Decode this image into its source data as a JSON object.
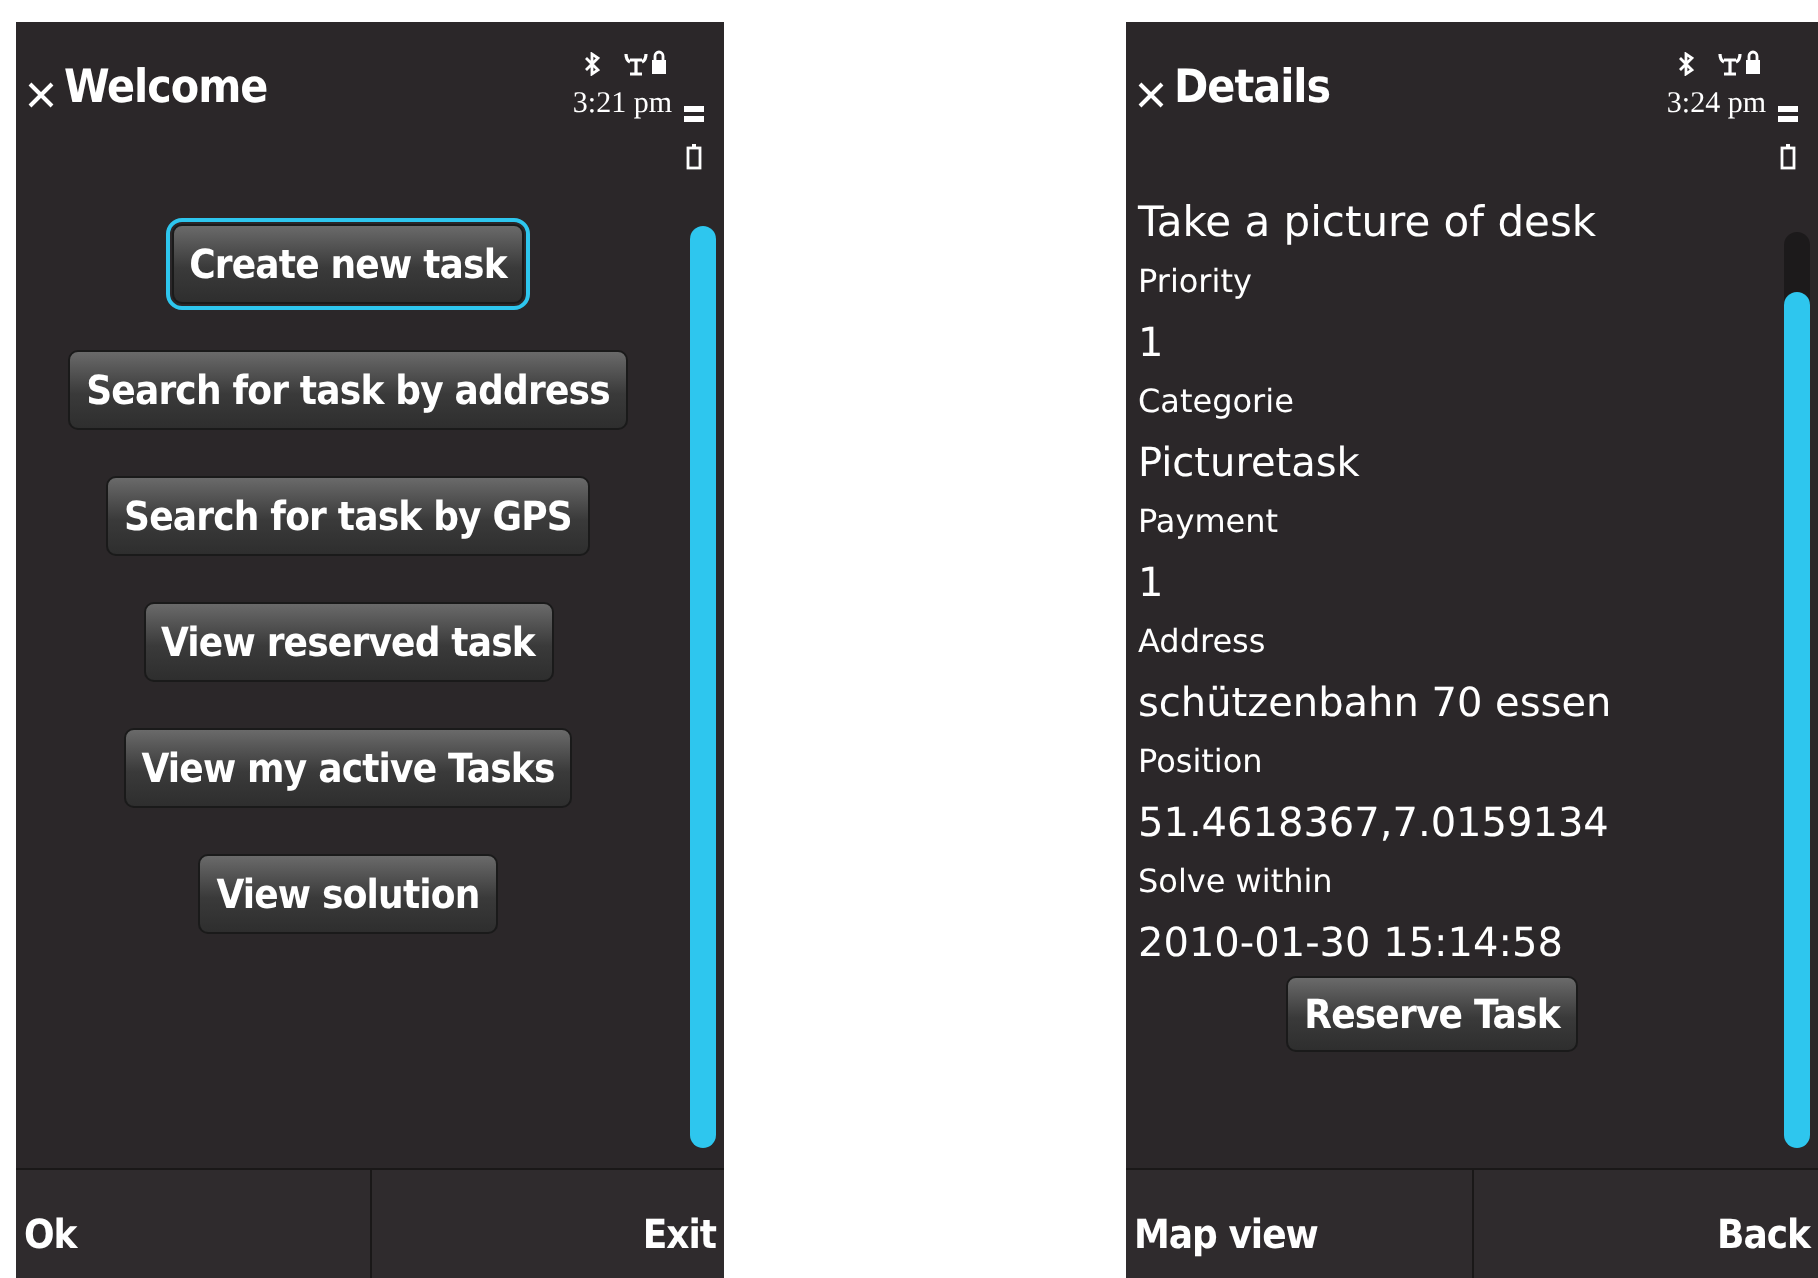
{
  "screens": [
    {
      "kind": "menu",
      "title": "Welcome",
      "time": "3:21 pm",
      "buttons": [
        {
          "label": "Create new task",
          "selected": true
        },
        {
          "label": "Search for task by address",
          "selected": false
        },
        {
          "label": "Search for task by GPS",
          "selected": false
        },
        {
          "label": "View reserved task",
          "selected": false
        },
        {
          "label": "View my active Tasks",
          "selected": false
        },
        {
          "label": "View solution",
          "selected": false
        }
      ],
      "softkeys": [
        "Ok",
        "Exit"
      ]
    },
    {
      "kind": "details",
      "title": "Details",
      "time": "3:24 pm",
      "heading": "Take a picture of desk",
      "fields": [
        {
          "label": "Priority",
          "value": "1"
        },
        {
          "label": "Categorie",
          "value": "Picturetask"
        },
        {
          "label": "Payment",
          "value": "1"
        },
        {
          "label": "Address",
          "value": "schützenbahn 70 essen"
        },
        {
          "label": "Position",
          "value": "51.4618367,7.0159134"
        },
        {
          "label": "Solve within",
          "value": "2010-01-30 15:14:58"
        }
      ],
      "button": "Reserve Task",
      "softkeys": [
        "Map view",
        "Back"
      ]
    }
  ]
}
